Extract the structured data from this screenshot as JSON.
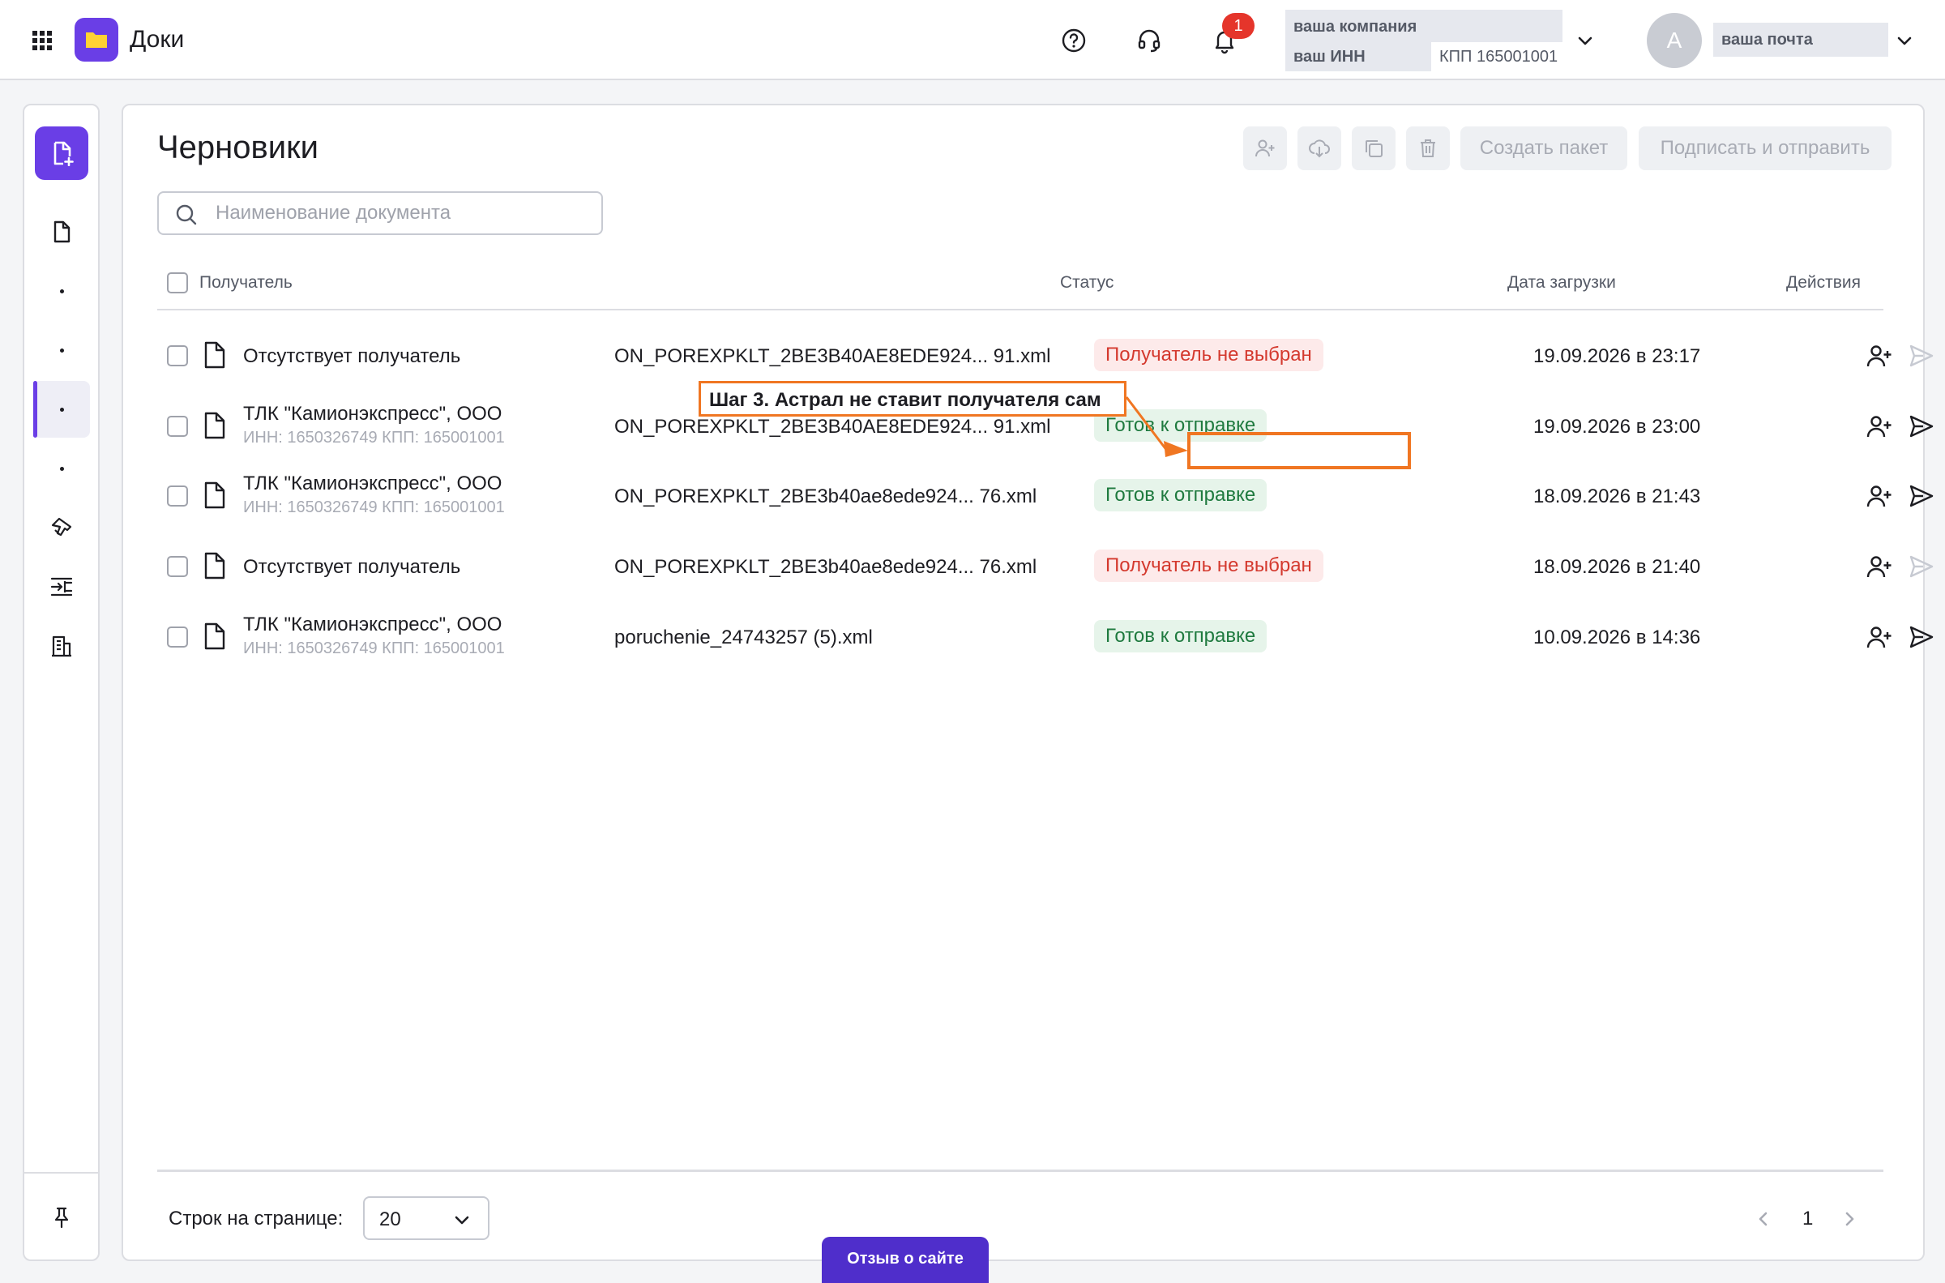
{
  "app": {
    "title": "Доки"
  },
  "header": {
    "notifications_count": "1",
    "company_name": "ваша компания",
    "company_inn": "ваш ИНН",
    "company_kpp": "КПП 165001001",
    "user_initial": "A",
    "user_email": "ваша почта"
  },
  "page": {
    "title": "Черновики",
    "search_placeholder": "Наименование документа",
    "create_package_label": "Создать пакет",
    "sign_send_label": "Подписать и отправить"
  },
  "table": {
    "columns": {
      "recipient": "Получатель",
      "status": "Статус",
      "upload_date": "Дата загрузки",
      "actions": "Действия"
    },
    "rows": [
      {
        "recipient": "Отсутствует получатель",
        "sub": "",
        "filename": "ON_POREXPKLT_2BE3B40AE8EDE924... 91.xml",
        "status": "Получатель не выбран",
        "status_kind": "error",
        "date": "19.09.2026 в 23:17",
        "send_enabled": false
      },
      {
        "recipient": "ТЛК \"Камионэкспресс\", ООО",
        "sub": "ИНН: 1650326749 КПП: 165001001",
        "filename": "ON_POREXPKLT_2BE3B40AE8EDE924... 91.xml",
        "status": "Готов к отправке",
        "status_kind": "ok",
        "date": "19.09.2026 в 23:00",
        "send_enabled": true
      },
      {
        "recipient": "ТЛК \"Камионэкспресс\", ООО",
        "sub": "ИНН: 1650326749 КПП: 165001001",
        "filename": "ON_POREXPKLT_2BE3b40ae8ede924... 76.xml",
        "status": "Готов к отправке",
        "status_kind": "ok",
        "date": "18.09.2026 в 21:43",
        "send_enabled": true
      },
      {
        "recipient": "Отсутствует получатель",
        "sub": "",
        "filename": "ON_POREXPKLT_2BE3b40ae8ede924... 76.xml",
        "status": "Получатель не выбран",
        "status_kind": "error",
        "date": "18.09.2026 в 21:40",
        "send_enabled": false
      },
      {
        "recipient": "ТЛК \"Камионэкспресс\", ООО",
        "sub": "ИНН: 1650326749 КПП: 165001001",
        "filename": "poruchenie_24743257 (5).xml",
        "status": "Готов к отправке",
        "status_kind": "ok",
        "date": "10.09.2026 в 14:36",
        "send_enabled": true
      }
    ]
  },
  "annotation": {
    "text": "Шаг 3. Астрал не ставит получателя сам"
  },
  "footer": {
    "rows_per_page_label": "Строк на странице:",
    "rows_per_page_value": "20",
    "current_page": "1"
  },
  "feedback_label": "Отзыв о сайте",
  "colors": {
    "accent": "#6a3ee6",
    "highlight": "#f07622",
    "ok": "#1f7a3f",
    "error": "#d4392e"
  },
  "icons": [
    "apps-icon",
    "folder-icon",
    "help-icon",
    "headset-icon",
    "bell-icon",
    "chevron-down-icon",
    "new-document-icon",
    "document-icon",
    "stamp-icon",
    "merge-icon",
    "building-icon",
    "pin-icon",
    "add-user-icon",
    "download-icon",
    "copy-icon",
    "trash-icon",
    "search-icon",
    "send-icon",
    "more-vertical-icon"
  ]
}
